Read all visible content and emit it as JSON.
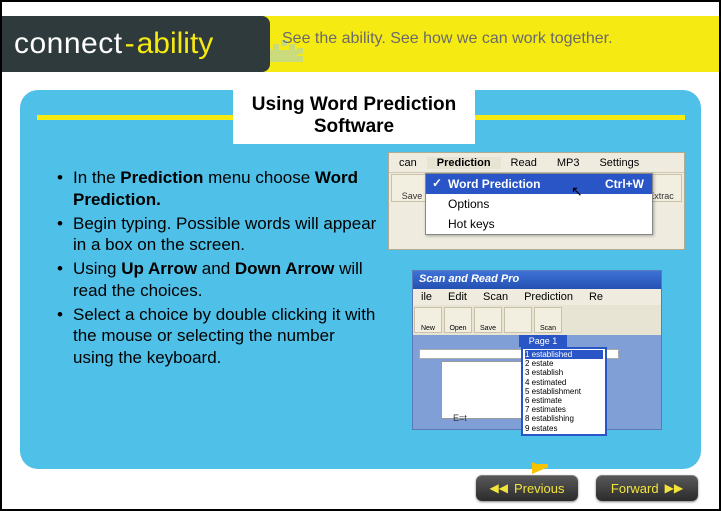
{
  "brand": {
    "part1": "connect",
    "dash": "-",
    "part2": "ability"
  },
  "tagline": "See the ability. See how we can work together.",
  "title": "Using Word Prediction Software",
  "bullets": [
    {
      "pre": " In the ",
      "b1": "Prediction",
      "mid": " menu choose ",
      "b2": "Word Prediction.",
      "post": ""
    },
    {
      "pre": " Begin typing.  Possible words will appear in a box on the screen.",
      "b1": "",
      "mid": "",
      "b2": "",
      "post": ""
    },
    {
      "pre": "Using ",
      "b1": "Up Arrow",
      "mid": " and ",
      "b2": "Down Arrow",
      "post": " will read the choices."
    },
    {
      "pre": "Select a choice by double clicking it with the mouse or selecting the number using the keyboard.",
      "b1": "",
      "mid": "",
      "b2": "",
      "post": ""
    }
  ],
  "mock1": {
    "menubar": [
      "can",
      "Prediction",
      "Read",
      "MP3",
      "Settings"
    ],
    "toolbar_left": "Save",
    "toolbar_right": "Extrac",
    "dropdown": [
      {
        "label": "Word Prediction",
        "accel": "Ctrl+W",
        "hl": true,
        "check": true
      },
      {
        "label": "Options",
        "accel": "",
        "hl": false,
        "check": false
      },
      {
        "label": "Hot keys",
        "accel": "",
        "hl": false,
        "check": false
      }
    ]
  },
  "mock2": {
    "title": "Scan and Read Pro",
    "menubar": [
      "ile",
      "Edit",
      "Scan",
      "Prediction",
      "Re"
    ],
    "toolbar": [
      "New",
      "Open",
      "Save",
      "",
      "Scan"
    ],
    "page_tab": "Page 1",
    "predictions": [
      "1 established",
      "2 estate",
      "3 establish",
      "4 estimated",
      "5 establishment",
      "6 estimate",
      "7 estimates",
      "8 establishing",
      "9 estates"
    ],
    "footer": "E=t"
  },
  "nav": {
    "previous": "Previous",
    "forward": "Forward"
  }
}
